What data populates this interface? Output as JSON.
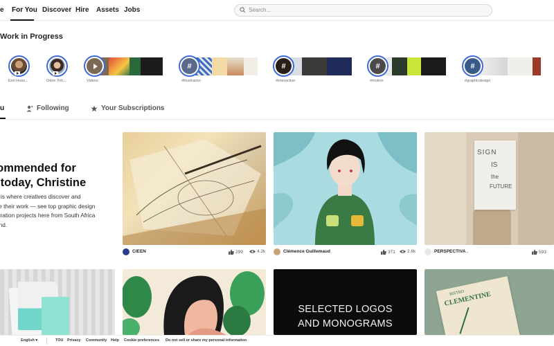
{
  "nav": {
    "logo_fragment": "e",
    "items": [
      "For You",
      "Discover",
      "Hire",
      "Assets",
      "Jobs"
    ],
    "search_placeholder": "Search..."
  },
  "wip": {
    "title": "Work in Progress",
    "stories": [
      {
        "label": "Erin Hues..."
      },
      {
        "label": "Odon Yoh..."
      },
      {
        "label": "Videos"
      },
      {
        "label": "#illustration"
      },
      {
        "label": "#interaction"
      },
      {
        "label": "#motion"
      },
      {
        "label": "#graphicdesign"
      }
    ],
    "hash_symbol": "#"
  },
  "tabs": {
    "for_you_fragment": "u",
    "following": "Following",
    "subscriptions": "Your Subscriptions"
  },
  "hero": {
    "title_line1": "commended for",
    "title_line2": "u today, Christine",
    "desc_line1": "e is where creatives discover and",
    "desc_line2": "se their work — see top graphic design",
    "desc_line3": "stration projects here from South Africa",
    "desc_line4": "ond."
  },
  "cards": [
    {
      "owner": "CIEEN",
      "likes": "299",
      "views": "4.2k"
    },
    {
      "owner": "Clémence Guillemaud",
      "likes": "371",
      "views": "2.6k"
    },
    {
      "owner": "PERSPECTIVA .",
      "likes": "593",
      "views": ""
    }
  ],
  "card_texts": {
    "logos_line1": "SELECTED LOGOS",
    "logos_line2": "AND MONOGRAMS",
    "poster_l1": "SIGN",
    "poster_l2": "IS",
    "poster_l3": "the",
    "poster_l4": "FUTURE",
    "clementine": "CLEMENTINE",
    "bistro": "BISTRO"
  },
  "footer": {
    "language": "English ▾",
    "links": [
      "TOU",
      "Privacy",
      "Community",
      "Help",
      "Cookie preferences",
      "Do not sell or share my personal information"
    ]
  },
  "icons": {
    "search": "search-icon",
    "following": "person-icon",
    "subscriptions": "star-icon",
    "likes": "thumbs-up-icon",
    "views": "eye-icon"
  },
  "colors": {
    "story_ring": "#3f6ad8",
    "text": "#191919"
  }
}
